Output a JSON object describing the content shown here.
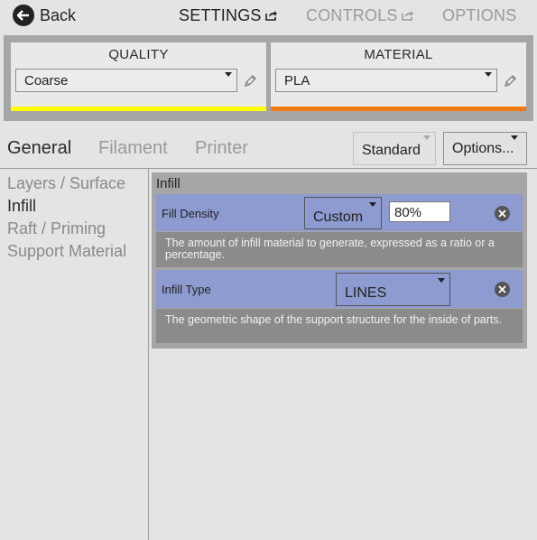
{
  "nav": {
    "back_label": "Back",
    "settings_label": "SETTINGS",
    "controls_label": "CONTROLS",
    "options_label": "OPTIONS"
  },
  "quality": {
    "title": "QUALITY",
    "selected": "Coarse",
    "color": "#ffff00"
  },
  "material": {
    "title": "MATERIAL",
    "selected": "PLA",
    "color": "#f07a12"
  },
  "categories": {
    "general": "General",
    "filament": "Filament",
    "printer": "Printer"
  },
  "toolbar": {
    "mode_label": "Standard",
    "options_label": "Options..."
  },
  "sidebar": {
    "items": [
      {
        "label": "Layers / Surface"
      },
      {
        "label": "Infill"
      },
      {
        "label": "Raft / Priming"
      },
      {
        "label": "Support Material"
      }
    ],
    "selected_index": 1
  },
  "section": {
    "title": "Infill",
    "settings": [
      {
        "label": "Fill Density",
        "dropdown": "Custom",
        "value": "80%",
        "description": "The amount of infill material to generate, expressed as a ratio or a percentage."
      },
      {
        "label": "Infill Type",
        "dropdown": "LINES",
        "description": "The geometric shape of the support structure for the inside of parts."
      }
    ]
  }
}
